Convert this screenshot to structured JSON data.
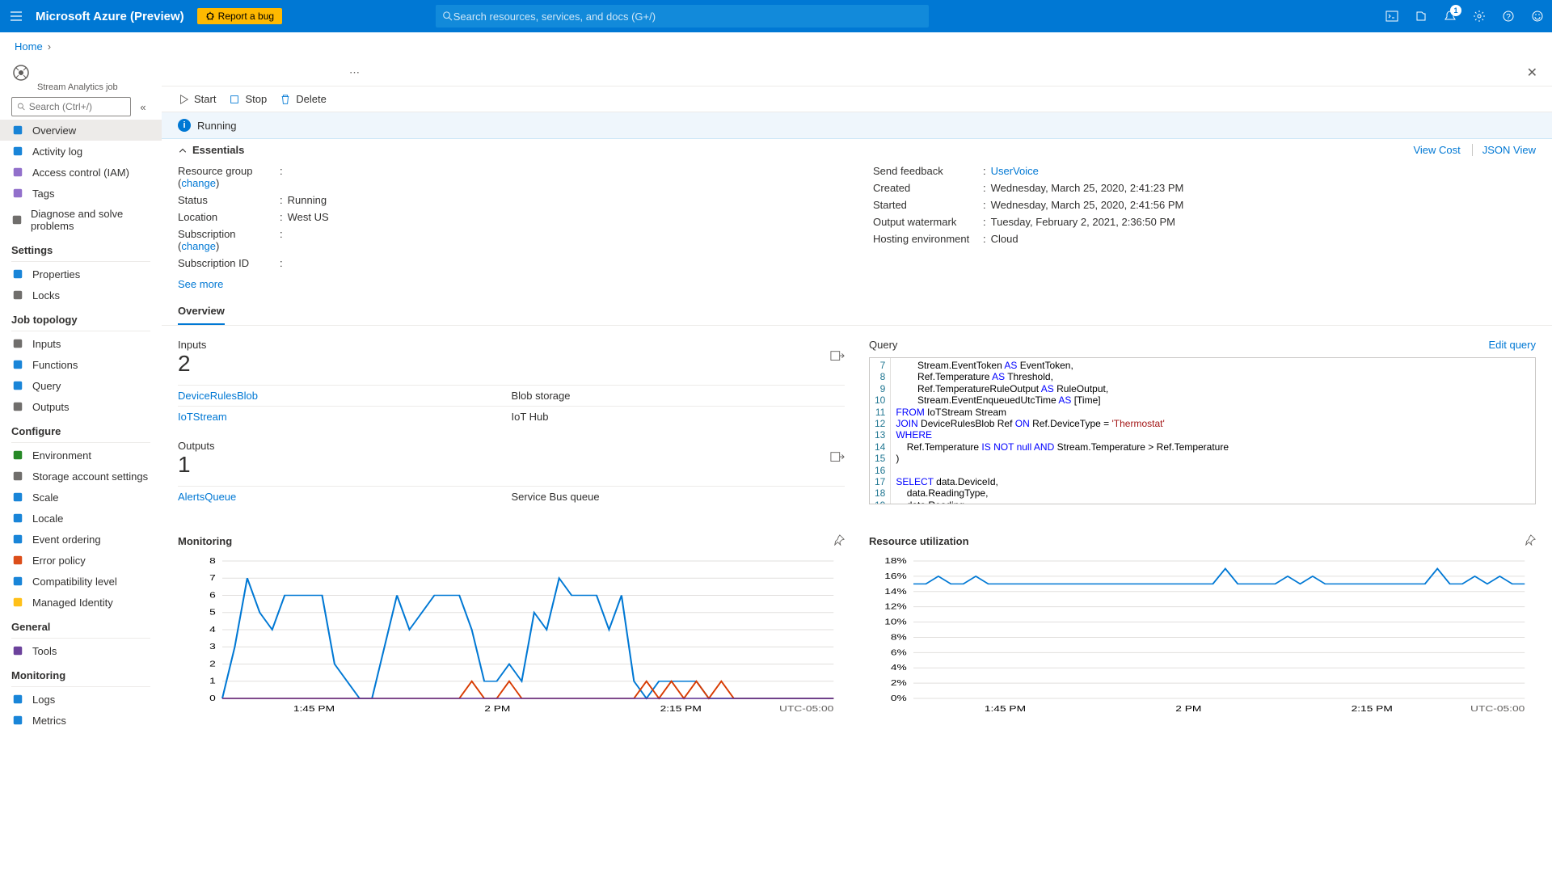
{
  "topbar": {
    "brand": "Microsoft Azure (Preview)",
    "bug_label": "Report a bug",
    "search_placeholder": "Search resources, services, and docs (G+/)",
    "notif_count": "1"
  },
  "breadcrumb": {
    "home": "Home"
  },
  "resource": {
    "subtype": "Stream Analytics job"
  },
  "sidebar": {
    "search_placeholder": "Search (Ctrl+/)",
    "items_top": [
      {
        "label": "Overview",
        "icon": "globe",
        "active": true
      },
      {
        "label": "Activity log",
        "icon": "log"
      },
      {
        "label": "Access control (IAM)",
        "icon": "people"
      },
      {
        "label": "Tags",
        "icon": "tag"
      },
      {
        "label": "Diagnose and solve problems",
        "icon": "wrench"
      }
    ],
    "sections": [
      {
        "title": "Settings",
        "items": [
          {
            "label": "Properties",
            "icon": "sliders"
          },
          {
            "label": "Locks",
            "icon": "lock"
          }
        ]
      },
      {
        "title": "Job topology",
        "items": [
          {
            "label": "Inputs",
            "icon": "in"
          },
          {
            "label": "Functions",
            "icon": "fn"
          },
          {
            "label": "Query",
            "icon": "code"
          },
          {
            "label": "Outputs",
            "icon": "out"
          }
        ]
      },
      {
        "title": "Configure",
        "items": [
          {
            "label": "Environment",
            "icon": "env"
          },
          {
            "label": "Storage account settings",
            "icon": "gear"
          },
          {
            "label": "Scale",
            "icon": "scale"
          },
          {
            "label": "Locale",
            "icon": "globe2"
          },
          {
            "label": "Event ordering",
            "icon": "order"
          },
          {
            "label": "Error policy",
            "icon": "err"
          },
          {
            "label": "Compatibility level",
            "icon": "compat"
          },
          {
            "label": "Managed Identity",
            "icon": "id"
          }
        ]
      },
      {
        "title": "General",
        "items": [
          {
            "label": "Tools",
            "icon": "tools"
          }
        ]
      },
      {
        "title": "Monitoring",
        "items": [
          {
            "label": "Logs",
            "icon": "logs"
          },
          {
            "label": "Metrics",
            "icon": "metrics"
          }
        ]
      }
    ]
  },
  "toolbar": {
    "start": "Start",
    "stop": "Stop",
    "delete": "Delete"
  },
  "status": {
    "text": "Running"
  },
  "essentials": {
    "label": "Essentials",
    "view_cost": "View Cost",
    "json_view": "JSON View",
    "left": [
      {
        "k": "Resource group",
        "change": "change",
        "v": ""
      },
      {
        "k": "Status",
        "v": "Running"
      },
      {
        "k": "Location",
        "v": "West US"
      },
      {
        "k": "Subscription",
        "change": "change",
        "v": ""
      },
      {
        "k": "Subscription ID",
        "v": ""
      }
    ],
    "right": [
      {
        "k": "Send feedback",
        "v": "UserVoice",
        "link": true
      },
      {
        "k": "Created",
        "v": "Wednesday, March 25, 2020, 2:41:23 PM"
      },
      {
        "k": "Started",
        "v": "Wednesday, March 25, 2020, 2:41:56 PM"
      },
      {
        "k": "Output watermark",
        "v": "Tuesday, February 2, 2021, 2:36:50 PM"
      },
      {
        "k": "Hosting environment",
        "v": "Cloud"
      }
    ],
    "see_more": "See more"
  },
  "tabs": {
    "overview": "Overview"
  },
  "inputs": {
    "title": "Inputs",
    "count": "2",
    "rows": [
      {
        "name": "DeviceRulesBlob",
        "type": "Blob storage"
      },
      {
        "name": "IoTStream",
        "type": "IoT Hub"
      }
    ]
  },
  "outputs": {
    "title": "Outputs",
    "count": "1",
    "rows": [
      {
        "name": "AlertsQueue",
        "type": "Service Bus queue"
      }
    ]
  },
  "query": {
    "title": "Query",
    "edit": "Edit query",
    "start_line": 7,
    "lines": [
      "        Stream.EventToken AS EventToken,",
      "        Ref.Temperature AS Threshold,",
      "        Ref.TemperatureRuleOutput AS RuleOutput,",
      "        Stream.EventEnqueuedUtcTime AS [Time]",
      "FROM IoTStream Stream",
      "JOIN DeviceRulesBlob Ref ON Ref.DeviceType = 'Thermostat'",
      "WHERE",
      "    Ref.Temperature IS NOT null AND Stream.Temperature > Ref.Temperature",
      ")",
      "",
      "SELECT data.DeviceId,",
      "    data.ReadingType,",
      "    data.Reading,"
    ]
  },
  "charts": {
    "monitoring": {
      "title": "Monitoring",
      "tz": "UTC-05:00"
    },
    "resource": {
      "title": "Resource utilization",
      "tz": "UTC-05:00"
    }
  },
  "chart_data": [
    {
      "type": "line",
      "id": "monitoring",
      "title": "Monitoring",
      "yticks": [
        0,
        1,
        2,
        3,
        4,
        5,
        6,
        7,
        8
      ],
      "xticks": [
        "1:45 PM",
        "2 PM",
        "2:15 PM"
      ],
      "series": [
        {
          "name": "blue",
          "color": "#0078d4",
          "values": [
            0,
            3,
            7,
            5,
            4,
            6,
            6,
            6,
            6,
            2,
            1,
            0,
            0,
            3,
            6,
            4,
            5,
            6,
            6,
            6,
            4,
            1,
            1,
            2,
            1,
            5,
            4,
            7,
            6,
            6,
            6,
            4,
            6,
            1,
            0,
            1,
            1,
            1,
            1,
            0,
            0,
            0,
            0,
            0,
            0,
            0,
            0,
            0,
            0,
            0
          ]
        },
        {
          "name": "orange",
          "color": "#d83b01",
          "values": [
            0,
            0,
            0,
            0,
            0,
            0,
            0,
            0,
            0,
            0,
            0,
            0,
            0,
            0,
            0,
            0,
            0,
            0,
            0,
            0,
            1,
            0,
            0,
            1,
            0,
            0,
            0,
            0,
            0,
            0,
            0,
            0,
            0,
            0,
            1,
            0,
            1,
            0,
            1,
            0,
            1,
            0,
            0,
            0,
            0,
            0,
            0,
            0,
            0,
            0
          ]
        },
        {
          "name": "purple",
          "color": "#5c2e91",
          "values": [
            0,
            0,
            0,
            0,
            0,
            0,
            0,
            0,
            0,
            0,
            0,
            0,
            0,
            0,
            0,
            0,
            0,
            0,
            0,
            0,
            0,
            0,
            0,
            0,
            0,
            0,
            0,
            0,
            0,
            0,
            0,
            0,
            0,
            0,
            0,
            0,
            0,
            0,
            0,
            0,
            0,
            0,
            0,
            0,
            0,
            0,
            0,
            0,
            0,
            0
          ]
        }
      ]
    },
    {
      "type": "line",
      "id": "resource",
      "title": "Resource utilization",
      "yticks": [
        "0%",
        "2%",
        "4%",
        "6%",
        "8%",
        "10%",
        "12%",
        "14%",
        "16%",
        "18%"
      ],
      "xticks": [
        "1:45 PM",
        "2 PM",
        "2:15 PM"
      ],
      "series": [
        {
          "name": "util",
          "color": "#0078d4",
          "values": [
            15,
            15,
            16,
            15,
            15,
            16,
            15,
            15,
            15,
            15,
            15,
            15,
            15,
            15,
            15,
            15,
            15,
            15,
            15,
            15,
            15,
            15,
            15,
            15,
            15,
            17,
            15,
            15,
            15,
            15,
            16,
            15,
            16,
            15,
            15,
            15,
            15,
            15,
            15,
            15,
            15,
            15,
            17,
            15,
            15,
            16,
            15,
            16,
            15,
            15
          ]
        }
      ]
    }
  ]
}
